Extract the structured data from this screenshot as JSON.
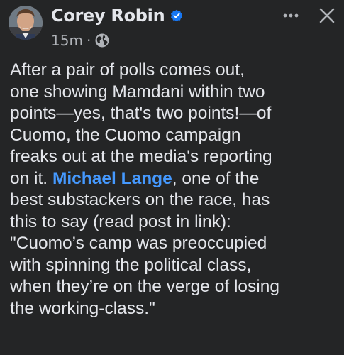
{
  "post": {
    "author": {
      "name": "Corey Robin",
      "verified": true,
      "avatar_icon": "profile-photo"
    },
    "meta": {
      "timestamp": "15m",
      "separator": "·",
      "audience_icon": "globe-icon"
    },
    "actions": {
      "more_icon": "more-horizontal-icon",
      "close_icon": "close-icon"
    },
    "body": {
      "line1": "After a pair of polls comes out,",
      "line2": "one showing Mamdani within two",
      "line3": "points—yes, that's two points!—of",
      "line4": "Cuomo, the Cuomo campaign",
      "line5": "freaks out at the media's reporting",
      "line6_pre": "on it. ",
      "mention": "Michael Lange",
      "line6_post": ", one of the",
      "line7": "best substackers on the race, has",
      "line8": "this to say (read post in link):",
      "line9": "\"Cuomo’s camp was preoccupied",
      "line10": "with spinning the political class,",
      "line11": "when they’re on the verge of losing",
      "line12": "the working-class.\""
    }
  },
  "colors": {
    "background": "#242526",
    "text_primary": "#e4e6eb",
    "text_secondary": "#b0b3b8",
    "link": "#4599ff",
    "verified_badge": "#1877f2"
  }
}
